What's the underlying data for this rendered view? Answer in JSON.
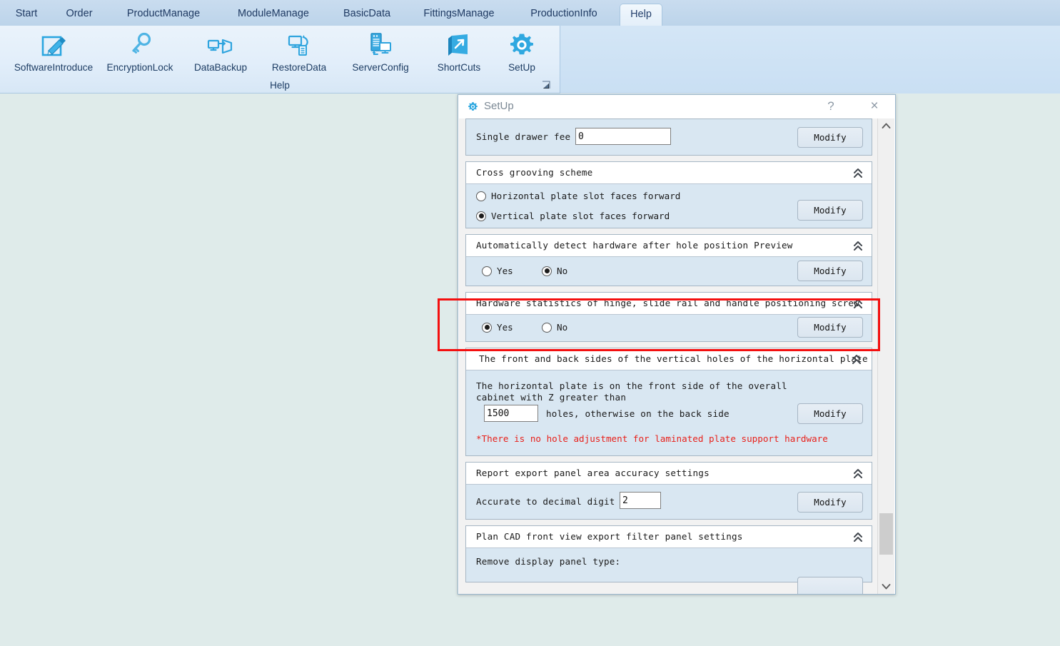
{
  "ribbon": {
    "tabs": [
      {
        "label": "Start",
        "active": false
      },
      {
        "label": "Order",
        "active": false
      },
      {
        "label": "ProductManage",
        "active": false
      },
      {
        "label": "ModuleManage",
        "active": false
      },
      {
        "label": "BasicData",
        "active": false
      },
      {
        "label": "FittingsManage",
        "active": false
      },
      {
        "label": "ProductionInfo",
        "active": false
      },
      {
        "label": "Help",
        "active": true
      }
    ],
    "group_label": "Help",
    "items": [
      {
        "label": "SoftwareIntroduce",
        "icon": "pencil-note-icon"
      },
      {
        "label": "EncryptionLock",
        "icon": "key-icon"
      },
      {
        "label": "DataBackup",
        "icon": "monitor-backup-icon"
      },
      {
        "label": "RestoreData",
        "icon": "monitor-restore-icon"
      },
      {
        "label": "ServerConfig",
        "icon": "server-monitor-icon"
      },
      {
        "label": "ShortCuts",
        "icon": "shortcut-arrow-icon"
      },
      {
        "label": "SetUp",
        "icon": "gear-icon"
      }
    ],
    "dialog_launcher_icon": "dialog-launcher-icon"
  },
  "dialog": {
    "title": "SetUp",
    "title_icon": "gear-icon",
    "help_button": "?",
    "close_button": "×",
    "collapse_icon": "double-chevron-up-icon",
    "modify_label": "Modify",
    "sections": [
      {
        "id": "single-drawer-fee",
        "has_header": false,
        "label": "Single drawer fee",
        "input_value": "0",
        "button": "Modify"
      },
      {
        "id": "cross-grooving-scheme",
        "header": "Cross grooving scheme",
        "options": [
          {
            "label": "Horizontal plate slot faces forward",
            "selected": false
          },
          {
            "label": "Vertical plate slot faces forward",
            "selected": true
          }
        ],
        "button": "Modify"
      },
      {
        "id": "auto-detect-hardware",
        "header": "Automatically detect hardware after hole position Preview",
        "options": [
          {
            "label": "Yes",
            "selected": false
          },
          {
            "label": "No",
            "selected": true
          }
        ],
        "button": "Modify"
      },
      {
        "id": "hardware-statistics",
        "header": "Hardware statistics of hinge, slide rail and handle positioning screw",
        "highlighted": true,
        "options": [
          {
            "label": "Yes",
            "selected": true
          },
          {
            "label": "No",
            "selected": false
          }
        ],
        "button": "Modify"
      },
      {
        "id": "vertical-holes-sides",
        "header": "The front and back sides of the vertical holes of the horizontal plate ar",
        "text_line1": "The horizontal plate is on the front side of the overall",
        "text_line2": "cabinet with Z greater than",
        "input_value": "1500",
        "text_after": "holes, otherwise on the back side",
        "note": "*There is no hole adjustment for laminated plate support hardware",
        "button": "Modify"
      },
      {
        "id": "report-export-accuracy",
        "header": "Report export panel area accuracy settings",
        "label": "Accurate to decimal digit",
        "input_value": "2",
        "button": "Modify"
      },
      {
        "id": "plan-cad-front-view",
        "header": "Plan CAD front view export filter panel settings",
        "label": "Remove display panel type:"
      }
    ]
  },
  "colors": {
    "desktop_bg": "#dfebea",
    "accent_blue": "#28a8e0",
    "highlight_red": "#f40f0f",
    "note_red": "#e8211b",
    "panel_bg": "#d9e7f2"
  }
}
